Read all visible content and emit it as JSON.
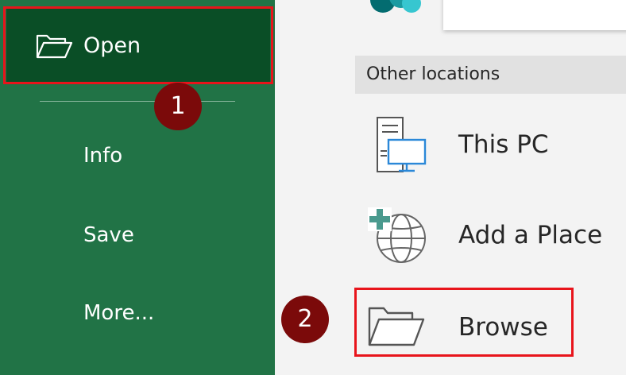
{
  "sidebar": {
    "open_label": "Open",
    "info_label": "Info",
    "save_label": "Save",
    "more_label": "More..."
  },
  "annotations": {
    "step_1": "1",
    "step_2": "2"
  },
  "main": {
    "section_header": "Other locations",
    "locations": [
      {
        "label": "This PC",
        "icon": "computer-icon"
      },
      {
        "label": "Add a Place",
        "icon": "add-place-globe-icon"
      },
      {
        "label": "Browse",
        "icon": "folder-open-icon"
      }
    ]
  },
  "colors": {
    "sidebar_bg": "#217346",
    "sidebar_selected_bg": "#0a4e26",
    "highlight_red": "#e8141b",
    "step_badge": "#7b0a0a",
    "section_header_bg": "#e1e1e1",
    "main_bg": "#f3f3f3",
    "icon_blue": "#2b88d8"
  }
}
